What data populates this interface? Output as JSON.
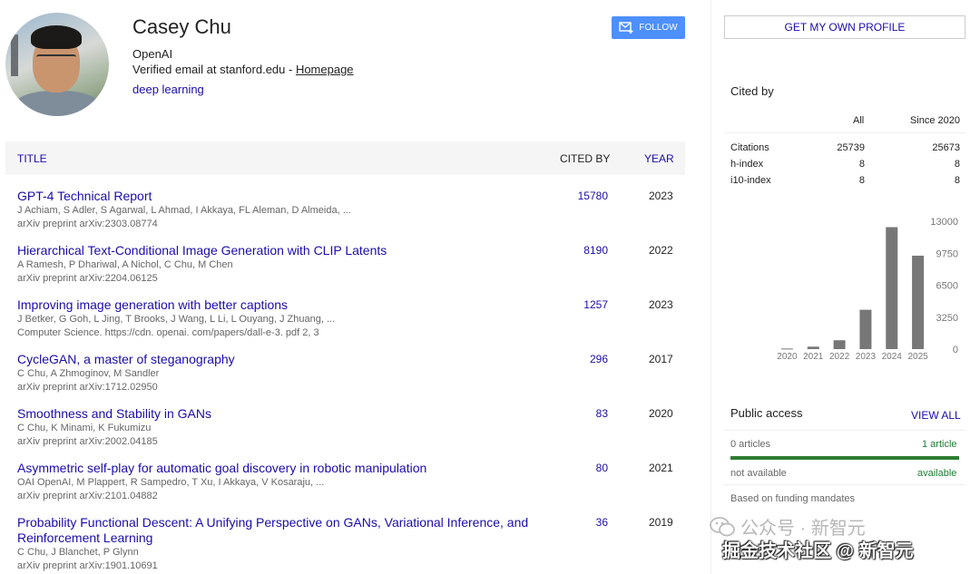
{
  "profile": {
    "name": "Casey Chu",
    "affiliation": "OpenAI",
    "email_text": "Verified email at stanford.edu - ",
    "homepage_label": "Homepage",
    "interest": "deep learning",
    "follow_label": "FOLLOW"
  },
  "table": {
    "col_title": "TITLE",
    "col_cited": "CITED BY",
    "col_year": "YEAR",
    "rows": [
      {
        "title": "GPT-4 Technical Report",
        "authors": "J Achiam, S Adler, S Agarwal, L Ahmad, I Akkaya, FL Aleman, D Almeida, ...",
        "venue": "arXiv preprint arXiv:2303.08774",
        "cited": "15780",
        "year": "2023"
      },
      {
        "title": "Hierarchical Text-Conditional Image Generation with CLIP Latents",
        "authors": "A Ramesh, P Dhariwal, A Nichol, C Chu, M Chen",
        "venue": "arXiv preprint arXiv:2204.06125",
        "cited": "8190",
        "year": "2022"
      },
      {
        "title": "Improving image generation with better captions",
        "authors": "J Betker, G Goh, L Jing, T Brooks, J Wang, L Li, L Ouyang, J Zhuang, ...",
        "venue": "Computer Science. https://cdn. openai. com/papers/dall-e-3. pdf 2, 3",
        "cited": "1257",
        "year": "2023"
      },
      {
        "title": "CycleGAN, a master of steganography",
        "authors": "C Chu, A Zhmoginov, M Sandler",
        "venue": "arXiv preprint arXiv:1712.02950",
        "cited": "296",
        "year": "2017"
      },
      {
        "title": "Smoothness and Stability in GANs",
        "authors": "C Chu, K Minami, K Fukumizu",
        "venue": "arXiv preprint arXiv:2002.04185",
        "cited": "83",
        "year": "2020"
      },
      {
        "title": "Asymmetric self-play for automatic goal discovery in robotic manipulation",
        "authors": "OAI OpenAI, M Plappert, R Sampedro, T Xu, I Akkaya, V Kosaraju, ...",
        "venue": "arXiv preprint arXiv:2101.04882",
        "cited": "80",
        "year": "2021"
      },
      {
        "title": "Probability Functional Descent: A Unifying Perspective on GANs, Variational Inference, and Reinforcement Learning",
        "authors": "C Chu, J Blanchet, P Glynn",
        "venue": "arXiv preprint arXiv:1901.10691",
        "cited": "36",
        "year": "2019"
      }
    ]
  },
  "sidebar": {
    "get_profile_label": "GET MY OWN PROFILE",
    "cited_by_title": "Cited by",
    "col_all": "All",
    "col_since": "Since 2020",
    "metrics": [
      {
        "label": "Citations",
        "all": "25739",
        "since": "25673"
      },
      {
        "label": "h-index",
        "all": "8",
        "since": "8"
      },
      {
        "label": "i10-index",
        "all": "8",
        "since": "8"
      }
    ],
    "public_access_title": "Public access",
    "view_all_label": "VIEW ALL",
    "articles_zero": "0 articles",
    "articles_one": "1 article",
    "not_available": "not available",
    "available": "available",
    "available_fraction": 1.0,
    "funding_note": "Based on funding mandates"
  },
  "watermark": {
    "line1": "公众号 · 新智元",
    "line2": "掘金技术社区 @ 新智元"
  },
  "colors": {
    "link": "#1a0dab",
    "follow_button": "#4d90fe",
    "bar": "#777777",
    "access_green": "#2e7d32"
  },
  "chart_data": {
    "type": "bar",
    "categories": [
      "2020",
      "2021",
      "2022",
      "2023",
      "2024",
      "2025"
    ],
    "values": [
      60,
      250,
      900,
      4000,
      12400,
      9500
    ],
    "title": "",
    "xlabel": "",
    "ylabel": "",
    "ylim": [
      0,
      13000
    ],
    "yticks": [
      "13000",
      "9750",
      "6500",
      "3250",
      "0"
    ],
    "ytick_values": [
      13000,
      9750,
      6500,
      3250,
      0
    ],
    "grid": false,
    "yaxis_side": "right"
  }
}
